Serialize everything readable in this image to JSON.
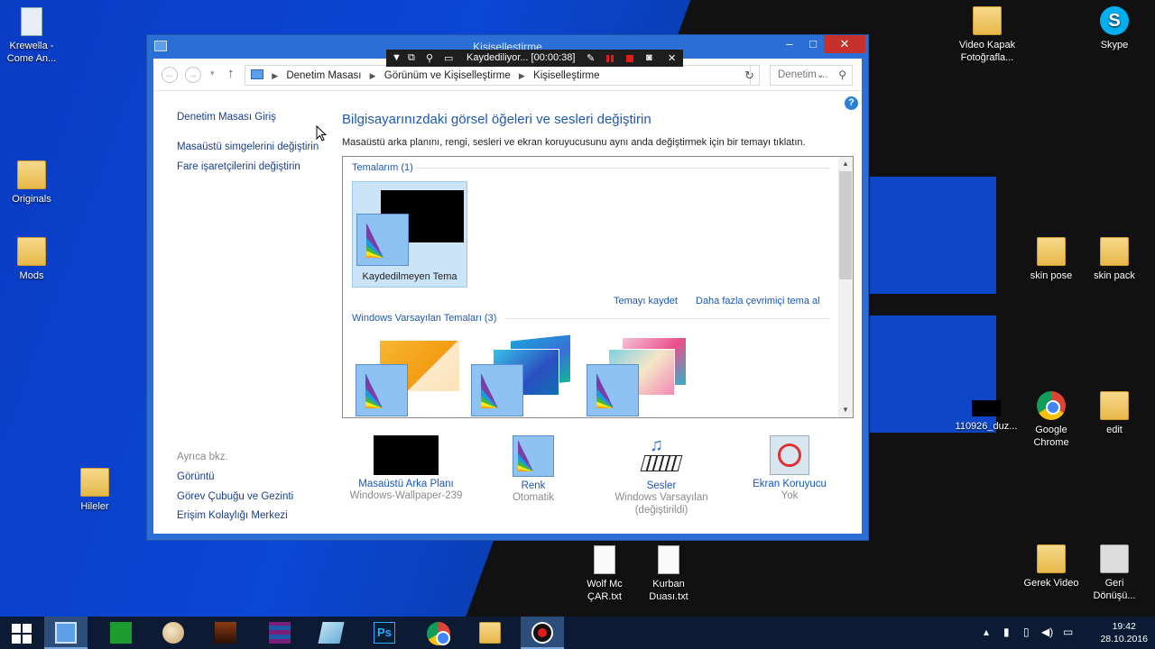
{
  "desktop": {
    "icons": [
      {
        "label": "Krewella -\nCome An...",
        "icon": "mp3-file-icon"
      },
      {
        "label": "Originals",
        "icon": "folder-icon"
      },
      {
        "label": "Mods",
        "icon": "folder-icon"
      },
      {
        "label": "Hileler",
        "icon": "folder-icon"
      },
      {
        "label": "Video Kapak\nFotoğrafla...",
        "icon": "folder-icon"
      },
      {
        "label": "Skype",
        "icon": "skype-icon"
      },
      {
        "label": "skin pose",
        "icon": "folder-icon"
      },
      {
        "label": "skin pack",
        "icon": "folder-icon"
      },
      {
        "label": "110926_duz...",
        "icon": "video-file-icon"
      },
      {
        "label": "Google\nChrome",
        "icon": "chrome-icon"
      },
      {
        "label": "edit",
        "icon": "folder-icon"
      },
      {
        "label": "Wolf Mc\nÇAR.txt",
        "icon": "text-file-icon"
      },
      {
        "label": "Kurban\nDuası.txt",
        "icon": "text-file-icon"
      },
      {
        "label": "Gerek Video",
        "icon": "folder-icon"
      },
      {
        "label": "Geri\nDönüşü...",
        "icon": "recycle-bin-icon"
      }
    ]
  },
  "window": {
    "title": "Kişiselleştirme",
    "breadcrumb": [
      "Denetim Masası",
      "Görünüm ve Kişiselleştirme",
      "Kişiselleştirme"
    ],
    "search_placeholder": "Denetim ...",
    "left_links": {
      "home": "Denetim Masası Giriş",
      "desktop_icons": "Masaüstü simgelerini değiştirin",
      "mouse_pointers": "Fare işaretçilerini değiştirin"
    },
    "see_also": {
      "header": "Ayrıca bkz.",
      "links": [
        "Görüntü",
        "Görev Çubuğu ve Gezinti",
        "Erişim Kolaylığı Merkezi"
      ]
    },
    "heading": "Bilgisayarınızdaki görsel öğeleri ve sesleri değiştirin",
    "description": "Masaüstü arka planını, rengi, sesleri ve ekran koruyucusunu aynı anda değiştirmek için bir temayı tıklatın.",
    "my_themes": {
      "header": "Temalarım (1)",
      "items": [
        {
          "label": "Kaydedilmeyen Tema"
        }
      ],
      "save_link": "Temayı kaydet",
      "online_link": "Daha fazla çevrimiçi tema al"
    },
    "default_themes": {
      "header": "Windows Varsayılan Temaları (3)"
    },
    "bottom": [
      {
        "title": "Masaüstü Arka Planı",
        "sub": "Windows-Wallpaper-239"
      },
      {
        "title": "Renk",
        "sub": "Otomatik"
      },
      {
        "title": "Sesler",
        "sub": "Windows Varsayılan\n(değiştirildi)"
      },
      {
        "title": "Ekran Koruyucu",
        "sub": "Yok"
      }
    ]
  },
  "recorder": {
    "status": "Kaydediliyor... [00:00:38]"
  },
  "taskbar": {
    "clock_time": "19:42",
    "clock_date": "28.10.2016"
  }
}
